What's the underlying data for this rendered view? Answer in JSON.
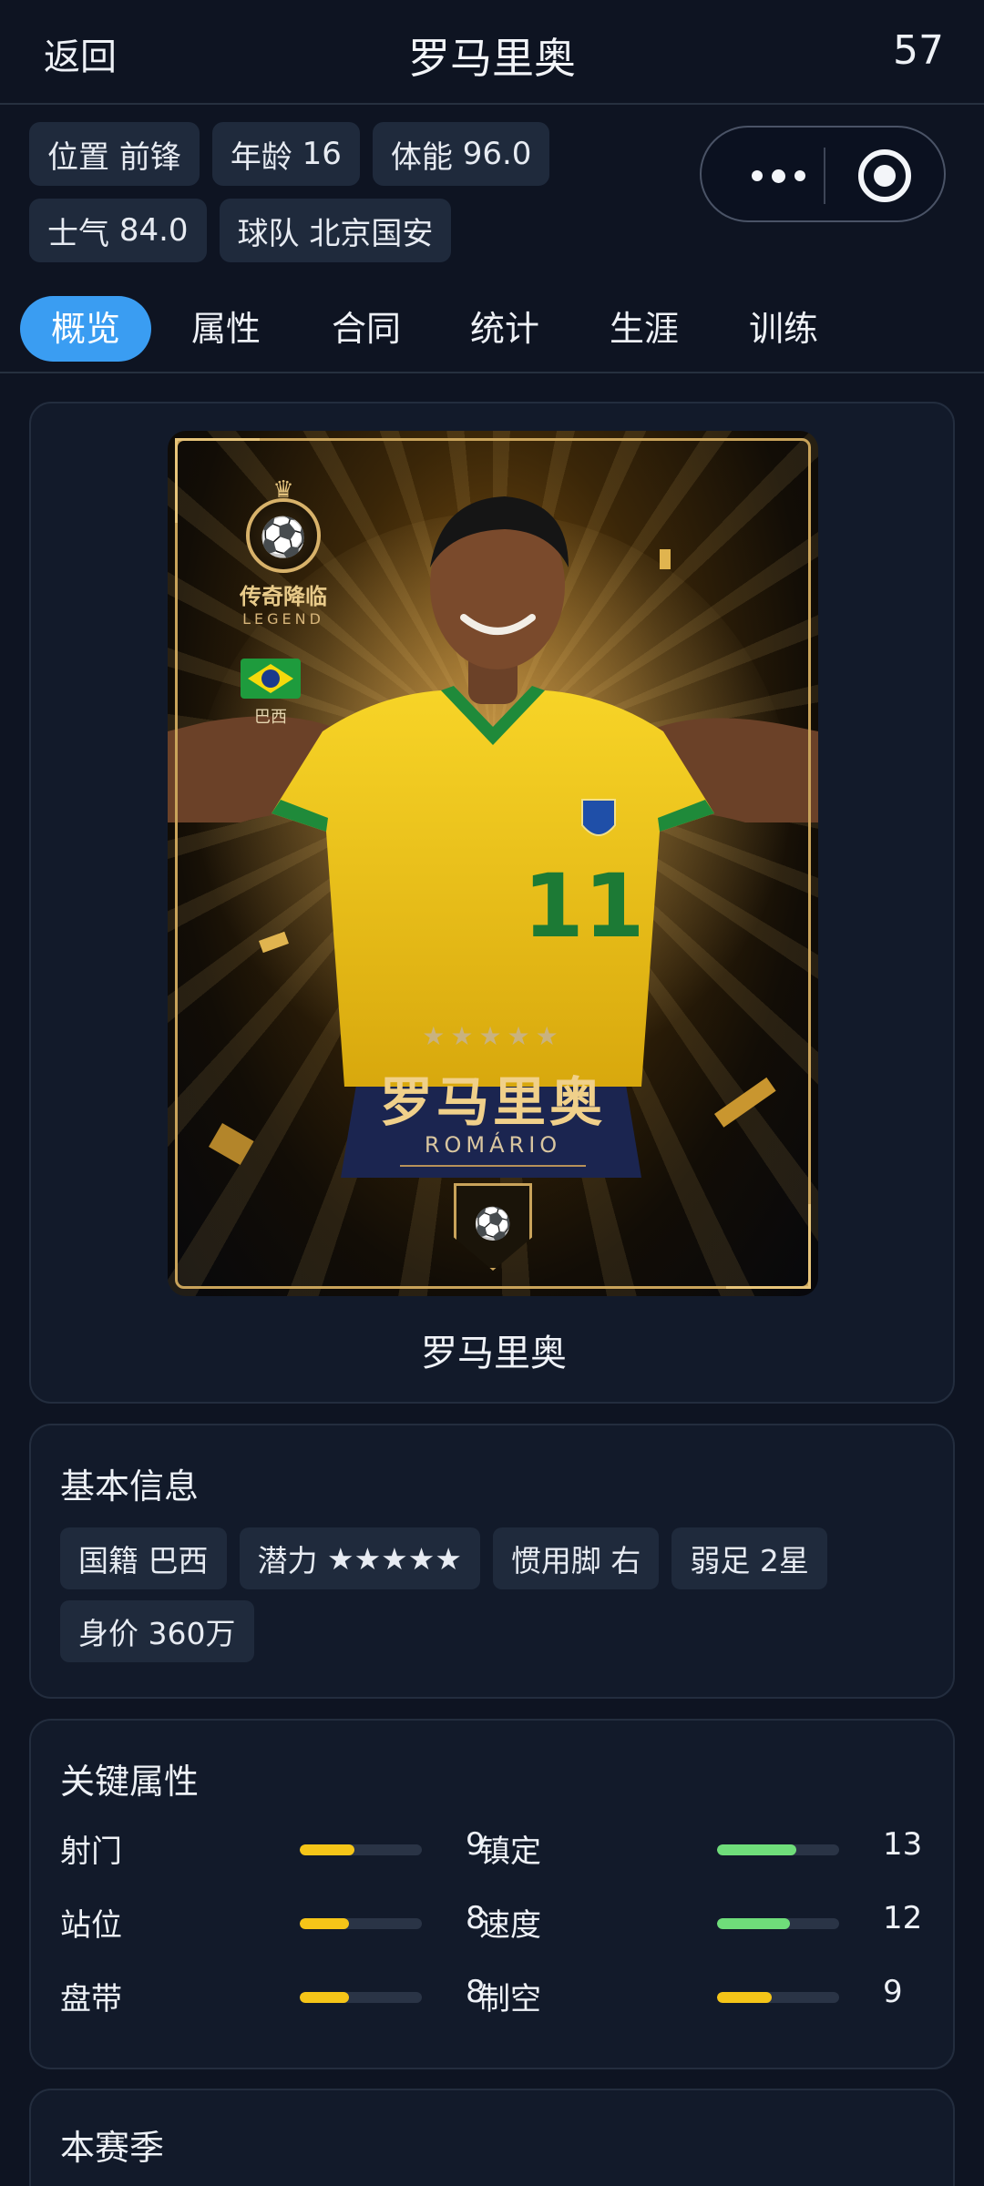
{
  "header": {
    "back_label": "返回",
    "title": "罗马里奥",
    "number": "57"
  },
  "chips": [
    {
      "label": "位置",
      "value": "前锋"
    },
    {
      "label": "年龄",
      "value": "16"
    },
    {
      "label": "体能",
      "value": "96.0"
    },
    {
      "label": "士气",
      "value": "84.0"
    },
    {
      "label": "球队",
      "value": "北京国安"
    }
  ],
  "capsule": {
    "more_icon": "more-dots-icon",
    "close_icon": "target-close-icon"
  },
  "tabs": [
    {
      "label": "概览",
      "active": true
    },
    {
      "label": "属性",
      "active": false
    },
    {
      "label": "合同",
      "active": false
    },
    {
      "label": "统计",
      "active": false
    },
    {
      "label": "生涯",
      "active": false
    },
    {
      "label": "训练",
      "active": false
    }
  ],
  "overview": {
    "card": {
      "badge_cn": "传奇降临",
      "badge_en": "LEGEND",
      "flag_label": "巴西",
      "stars": "★★★★★",
      "name_cn": "罗马里奥",
      "name_en": "ROMÁRIO",
      "jersey_number": "11"
    },
    "caption": "罗马里奥"
  },
  "basic_info": {
    "title": "基本信息",
    "items": [
      {
        "label": "国籍",
        "value": "巴西"
      },
      {
        "label": "潜力",
        "value": "★★★★★"
      },
      {
        "label": "惯用脚",
        "value": "右"
      },
      {
        "label": "弱足",
        "value": "2星"
      },
      {
        "label": "身价",
        "value": "360万"
      }
    ]
  },
  "key_attributes": {
    "title": "关键属性",
    "max": 20,
    "colors": {
      "yellow": "#f5c518",
      "green": "#6fdd7a"
    },
    "items": [
      {
        "name": "射门",
        "value": 9,
        "color": "yellow"
      },
      {
        "name": "镇定",
        "value": 13,
        "color": "green"
      },
      {
        "name": "站位",
        "value": 8,
        "color": "yellow"
      },
      {
        "name": "速度",
        "value": 12,
        "color": "green"
      },
      {
        "name": "盘带",
        "value": 8,
        "color": "yellow"
      },
      {
        "name": "制空",
        "value": 9,
        "color": "yellow"
      }
    ]
  },
  "season": {
    "title": "本赛季"
  },
  "colors": {
    "accent": "#3a9df2",
    "background": "#0e1422",
    "card": "#121a2a",
    "chip": "#1f2a3c"
  }
}
